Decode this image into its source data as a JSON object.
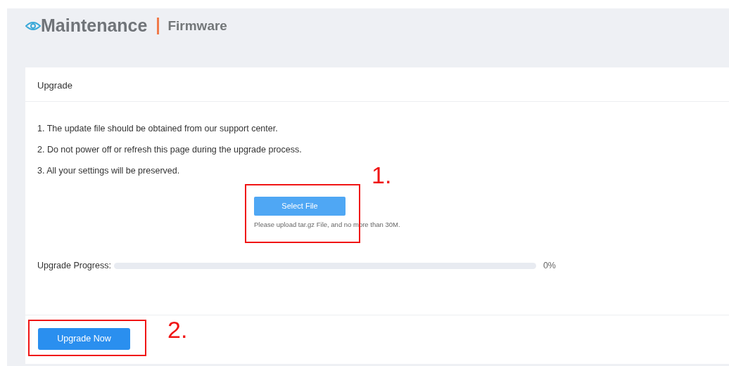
{
  "header": {
    "title": "Maintenance",
    "subtitle": "Firmware"
  },
  "card": {
    "title": "Upgrade",
    "notes": [
      "1. The update file should be obtained from our support center.",
      "2. Do not power off or refresh this page during the upgrade process.",
      "3. All your settings will be preserved."
    ],
    "select_button": "Select File",
    "hint": "Please upload tar.gz File, and no more than 30M.",
    "progress": {
      "label": "Upgrade Progress:",
      "level": 0,
      "reading": "0%"
    },
    "upgrade_button": "Upgrade Now"
  },
  "annotations": [
    {
      "label": "1."
    },
    {
      "label": "2."
    }
  ]
}
